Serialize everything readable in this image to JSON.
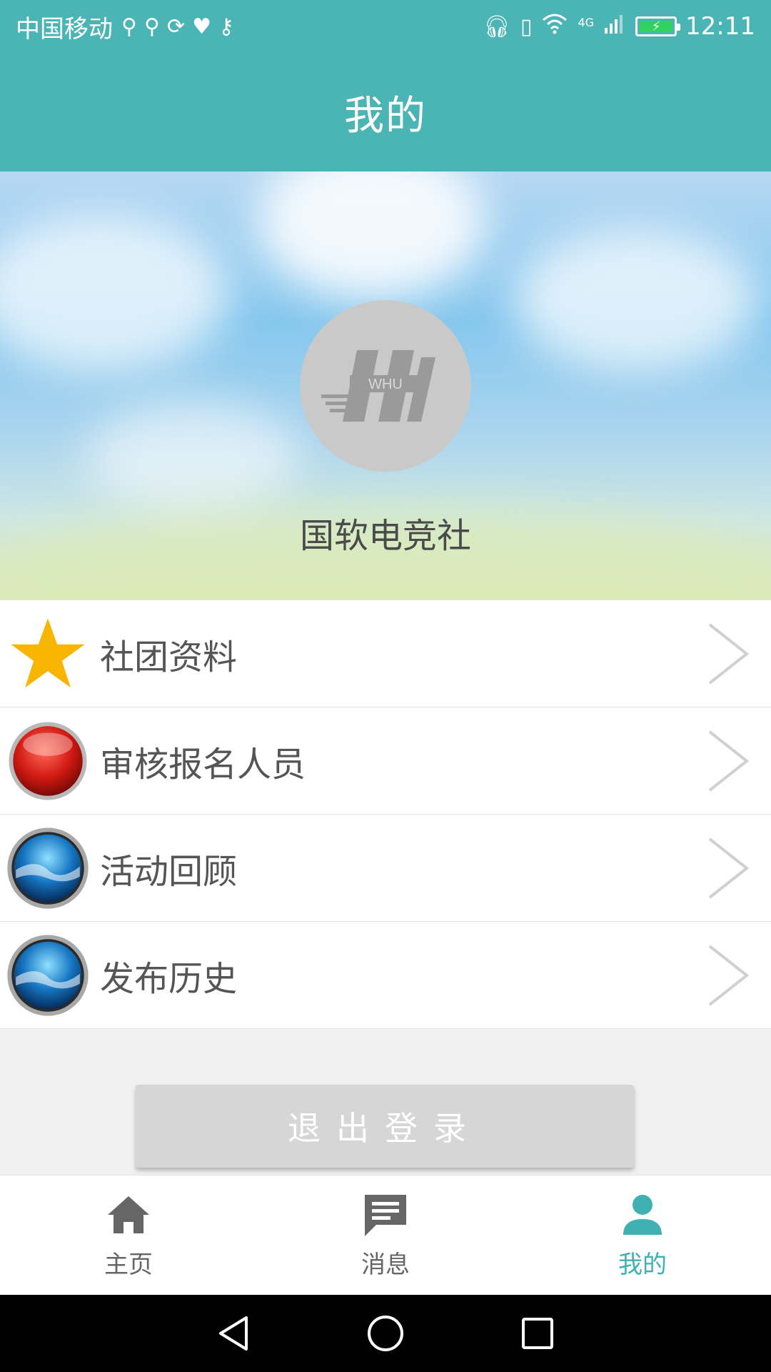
{
  "status_bar": {
    "carrier": "中国移动",
    "network": "4G",
    "time": "12:11",
    "battery_color": "#31d160"
  },
  "header": {
    "title": "我的",
    "color": "#4bb4b5"
  },
  "profile": {
    "club_name": "国软电竞社",
    "avatar_logo_text": "WHU"
  },
  "menu": {
    "items": [
      {
        "label": "社团资料",
        "icon": "star-icon"
      },
      {
        "label": "审核报名人员",
        "icon": "red-orb-icon"
      },
      {
        "label": "活动回顾",
        "icon": "blue-orb-icon"
      },
      {
        "label": "发布历史",
        "icon": "blue-orb-icon"
      }
    ]
  },
  "logout": {
    "label": "退出登录"
  },
  "bottom_nav": {
    "items": [
      {
        "label": "主页",
        "icon": "home-icon",
        "active": false
      },
      {
        "label": "消息",
        "icon": "message-icon",
        "active": false
      },
      {
        "label": "我的",
        "icon": "person-icon",
        "active": true
      }
    ],
    "active_color": "#3fb1b3"
  },
  "system_nav": {
    "buttons": [
      "back-icon",
      "home-circle-icon",
      "recents-icon"
    ]
  }
}
